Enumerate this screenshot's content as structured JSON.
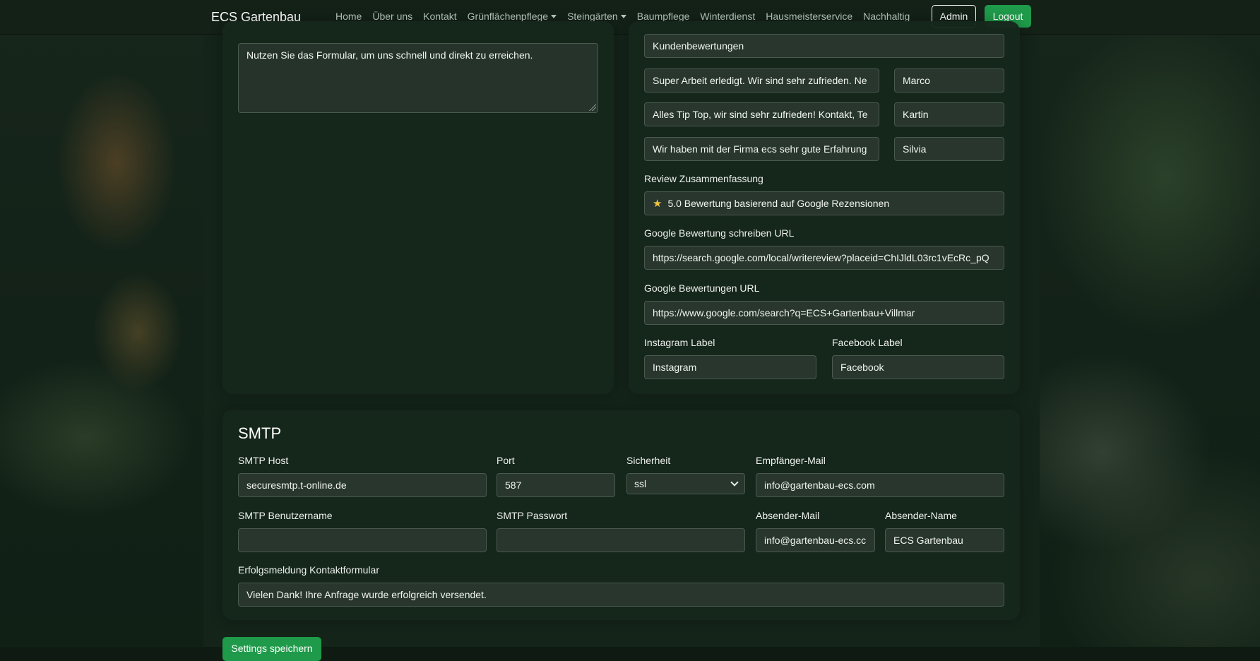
{
  "navbar": {
    "brand": "ECS Gartenbau",
    "items": [
      "Home",
      "Über uns",
      "Kontakt",
      "Grünflächenpflege",
      "Steingärten",
      "Baumpflege",
      "Winterdienst",
      "Hausmeisterservice",
      "Nachhaltig"
    ],
    "dropdown_items": [
      "Grünflächenpflege",
      "Steingärten"
    ],
    "admin_label": "Admin",
    "logout_label": "Logout"
  },
  "left_card": {
    "textarea_value": "Nutzen Sie das Formular, um uns schnell und direkt zu erreichen."
  },
  "right_card": {
    "section_heading_value": "Kundenbewertungen",
    "reviews": [
      {
        "text": "Super Arbeit erledigt. Wir sind sehr zufrieden. Ne",
        "name": "Marco"
      },
      {
        "text": "Alles Tip Top, wir sind sehr zufrieden! Kontakt, Te",
        "name": "Kartin"
      },
      {
        "text": "Wir haben mit der Firma ecs sehr gute Erfahrung",
        "name": "Silvia"
      }
    ],
    "review_summary_label": "Review Zusammenfassung",
    "review_summary_value": "5.0 Bewertung basierend auf Google Rezensionen",
    "google_write_label": "Google Bewertung schreiben URL",
    "google_write_value": "https://search.google.com/local/writereview?placeid=ChIJldL03rc1vEcRc_pQ",
    "google_reviews_label": "Google Bewertungen URL",
    "google_reviews_value": "https://www.google.com/search?q=ECS+Gartenbau+Villmar",
    "instagram_label": "Instagram Label",
    "instagram_value": "Instagram",
    "facebook_label": "Facebook Label",
    "facebook_value": "Facebook"
  },
  "smtp": {
    "title": "SMTP",
    "host_label": "SMTP Host",
    "host_value": "securesmtp.t-online.de",
    "port_label": "Port",
    "port_value": "587",
    "security_label": "Sicherheit",
    "security_value": "ssl",
    "recipient_label": "Empfänger-Mail",
    "recipient_value": "info@gartenbau-ecs.com",
    "username_label": "SMTP Benutzername",
    "username_value": "",
    "password_label": "SMTP Passwort",
    "password_value": "",
    "sender_mail_label": "Absender-Mail",
    "sender_mail_value": "info@gartenbau-ecs.cc",
    "sender_name_label": "Absender-Name",
    "sender_name_value": "ECS Gartenbau",
    "success_label": "Erfolgsmeldung Kontaktformular",
    "success_value": "Vielen Dank! Ihre Anfrage wurde erfolgreich versendet."
  },
  "save_button_label": "Settings speichern"
}
